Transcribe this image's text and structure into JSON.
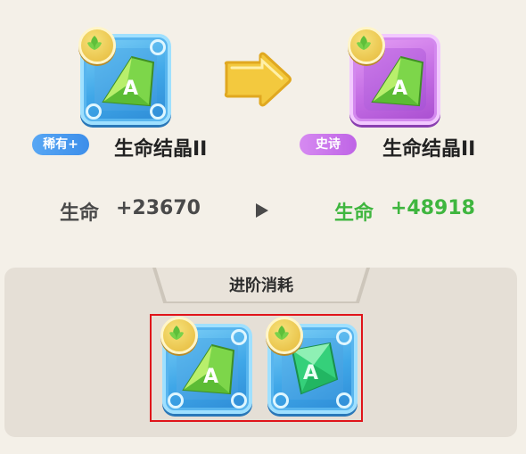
{
  "upgrade": {
    "from": {
      "rarity_label": "稀有+",
      "name": "生命结晶II",
      "stat_label": "生命",
      "stat_value": "+23670",
      "frame_color": "#3fa7e8",
      "icon": "green-crystal-icon"
    },
    "to": {
      "rarity_label": "史诗",
      "name": "生命结晶II",
      "stat_label": "生命",
      "stat_value": "+48918",
      "frame_color": "#c46de4",
      "icon": "green-crystal-icon"
    },
    "arrow_icon": "yellow-arrow-right-icon",
    "stat_arrow_icon": "play-triangle-icon"
  },
  "cost": {
    "title": "进阶消耗",
    "items": [
      {
        "icon": "green-crystal-icon",
        "frame": "blue"
      },
      {
        "icon": "emerald-crystal-icon",
        "frame": "blue"
      }
    ]
  },
  "colors": {
    "background": "#f4f0e8",
    "stat_increase": "#3fb63f",
    "rare_badge": "#4a9bef",
    "epic_badge": "#c874e8",
    "highlight": "#e0141a"
  }
}
